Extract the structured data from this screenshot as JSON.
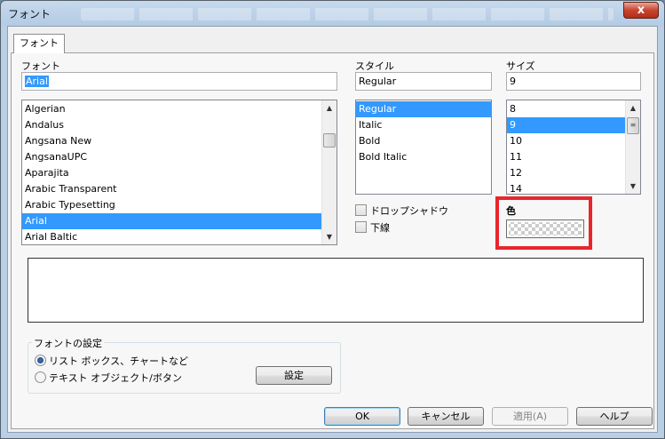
{
  "window": {
    "title": "フォント",
    "close_label": "x"
  },
  "tab": {
    "label": "フォント"
  },
  "font": {
    "label": "フォント",
    "value": "Arial",
    "items": [
      "Algerian",
      "Andalus",
      "Angsana New",
      "AngsanaUPC",
      "Aparajita",
      "Arabic Transparent",
      "Arabic Typesetting",
      "Arial",
      "Arial Baltic"
    ],
    "selected": "Arial"
  },
  "style": {
    "label": "スタイル",
    "value": "Regular",
    "items": [
      "Regular",
      "Italic",
      "Bold",
      "Bold Italic"
    ],
    "selected": "Regular"
  },
  "size": {
    "label": "サイズ",
    "value": "9",
    "items": [
      "8",
      "9",
      "10",
      "11",
      "12",
      "14"
    ],
    "selected": "9"
  },
  "effects": {
    "drop_shadow": {
      "label": "ドロップシャドウ",
      "checked": false
    },
    "underline": {
      "label": "下線",
      "checked": false
    }
  },
  "color": {
    "label": "色"
  },
  "font_settings": {
    "title": "フォントの設定",
    "option_list": "リスト ボックス、チャートなど",
    "option_text": "テキスト オブジェクト/ボタン",
    "selected": "option_list",
    "settings_button": "設定"
  },
  "buttons": {
    "ok": "OK",
    "cancel": "キャンセル",
    "apply": "適用(A)",
    "help": "ヘルプ"
  },
  "colors": {
    "selection": "#3399ff",
    "highlight_border": "#e8262b"
  }
}
